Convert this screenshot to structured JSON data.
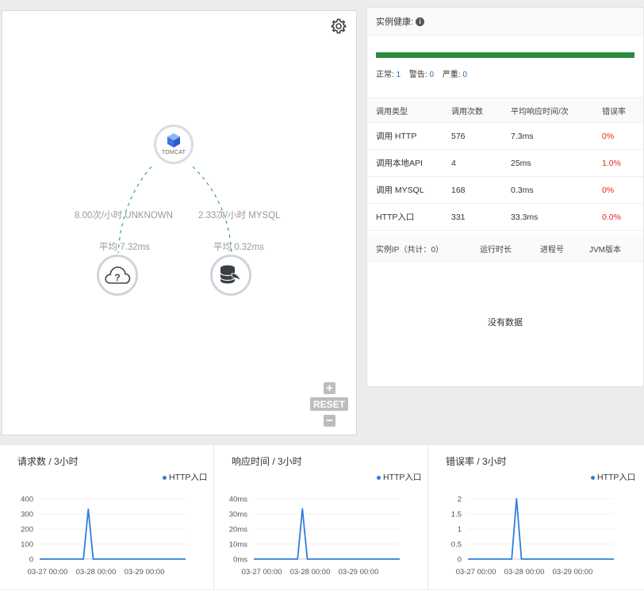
{
  "topology": {
    "center_node": {
      "name": "TOMCAT"
    },
    "edges": [
      {
        "target": "UNKNOWN",
        "rate_label": "8.00次/小时 UNKNOWN",
        "avg_label": "平均 7.32ms"
      },
      {
        "target": "MYSQL",
        "rate_label": "2.33次/小时 MYSQL",
        "avg_label": "平均 0.32ms"
      }
    ],
    "controls": {
      "plus": "+",
      "reset": "RESET",
      "minus": "−"
    }
  },
  "health": {
    "title": "实例健康:",
    "normal_label": "正常:",
    "normal_count": "1",
    "warning_label": "警告:",
    "warning_count": "0",
    "severe_label": "严重:",
    "severe_count": "0",
    "bar_fraction": 1.0,
    "bar_color": "#2a8a3e"
  },
  "calls_table": {
    "headers": [
      "调用类型",
      "调用次数",
      "平均响应时间/次",
      "错误率"
    ],
    "rows": [
      {
        "type": "调用 HTTP",
        "count": "576",
        "avg": "7.3ms",
        "error": "0%"
      },
      {
        "type": "调用本地API",
        "count": "4",
        "avg": "25ms",
        "error": "1.0%"
      },
      {
        "type": "调用 MYSQL",
        "count": "168",
        "avg": "0.3ms",
        "error": "0%"
      },
      {
        "type": "HTTP入口",
        "count": "331",
        "avg": "33.3ms",
        "error": "0.0%"
      }
    ]
  },
  "instances_table": {
    "headers": [
      "实例IP（共计：0）",
      "运行时长",
      "进程号",
      "JVM版本"
    ],
    "empty_text": "没有数据"
  },
  "chart_data": [
    {
      "type": "line",
      "title": "请求数 / 3小时",
      "series": [
        {
          "name": "HTTP入口",
          "color": "#2f7ddb",
          "values": [
            0,
            0,
            0,
            0,
            0,
            0,
            0,
            0,
            0,
            0,
            331,
            0,
            0,
            0,
            0,
            0,
            0,
            0,
            0,
            0,
            0,
            0,
            0,
            0,
            0,
            0,
            0,
            0,
            0,
            0,
            0
          ]
        }
      ],
      "x_ticks": [
        "03-27 00:00",
        "03-28 00:00",
        "03-29 00:00"
      ],
      "y_ticks": [
        "0",
        "100",
        "200",
        "300",
        "400"
      ],
      "ylim": [
        0,
        400
      ]
    },
    {
      "type": "line",
      "title": "响应时间 / 3小时",
      "series": [
        {
          "name": "HTTP入口",
          "color": "#2f7ddb",
          "values": [
            0,
            0,
            0,
            0,
            0,
            0,
            0,
            0,
            0,
            0,
            33.3,
            0,
            0,
            0,
            0,
            0,
            0,
            0,
            0,
            0,
            0,
            0,
            0,
            0,
            0,
            0,
            0,
            0,
            0,
            0,
            0
          ]
        }
      ],
      "x_ticks": [
        "03-27 00:00",
        "03-28 00:00",
        "03-29 00:00"
      ],
      "y_ticks": [
        "0ms",
        "10ms",
        "20ms",
        "30ms",
        "40ms"
      ],
      "ylim": [
        0,
        40
      ]
    },
    {
      "type": "line",
      "title": "错误率 / 3小时",
      "series": [
        {
          "name": "HTTP入口",
          "color": "#2f7ddb",
          "values": [
            0,
            0,
            0,
            0,
            0,
            0,
            0,
            0,
            0,
            0,
            2,
            0,
            0,
            0,
            0,
            0,
            0,
            0,
            0,
            0,
            0,
            0,
            0,
            0,
            0,
            0,
            0,
            0,
            0,
            0,
            0
          ]
        }
      ],
      "x_ticks": [
        "03-27 00:00",
        "03-28 00:00",
        "03-29 00:00"
      ],
      "y_ticks": [
        "0",
        "0.5",
        "1",
        "1.5",
        "2"
      ],
      "ylim": [
        0,
        2
      ]
    }
  ]
}
